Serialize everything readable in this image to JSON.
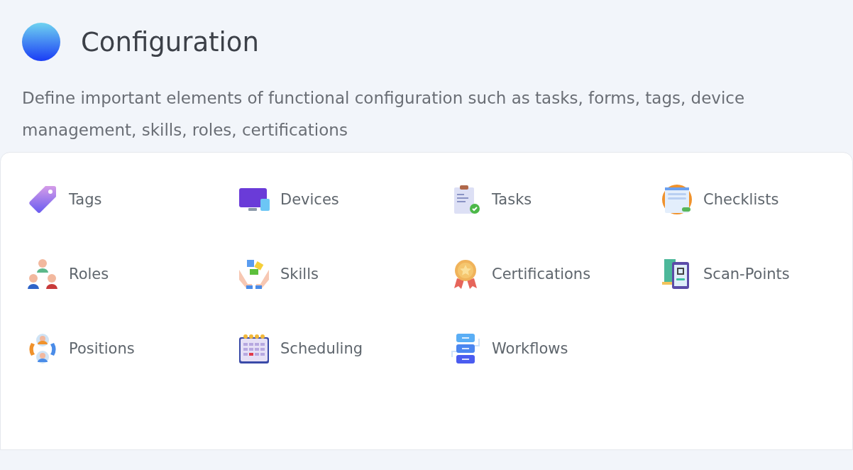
{
  "header": {
    "title": "Configuration",
    "description": "Define important elements of functional configuration such as tasks, forms, tags, device management, skills, roles, certifications"
  },
  "items": [
    {
      "label": "Tags",
      "kind": "tag"
    },
    {
      "label": "Devices",
      "kind": "devices"
    },
    {
      "label": "Tasks",
      "kind": "tasks"
    },
    {
      "label": "Checklists",
      "kind": "checklist"
    },
    {
      "label": "Roles",
      "kind": "roles"
    },
    {
      "label": "Skills",
      "kind": "skills"
    },
    {
      "label": "Certifications",
      "kind": "medal"
    },
    {
      "label": "Scan-Points",
      "kind": "scan"
    },
    {
      "label": "Positions",
      "kind": "positions"
    },
    {
      "label": "Scheduling",
      "kind": "calendar"
    },
    {
      "label": "Workflows",
      "kind": "workflow"
    }
  ]
}
